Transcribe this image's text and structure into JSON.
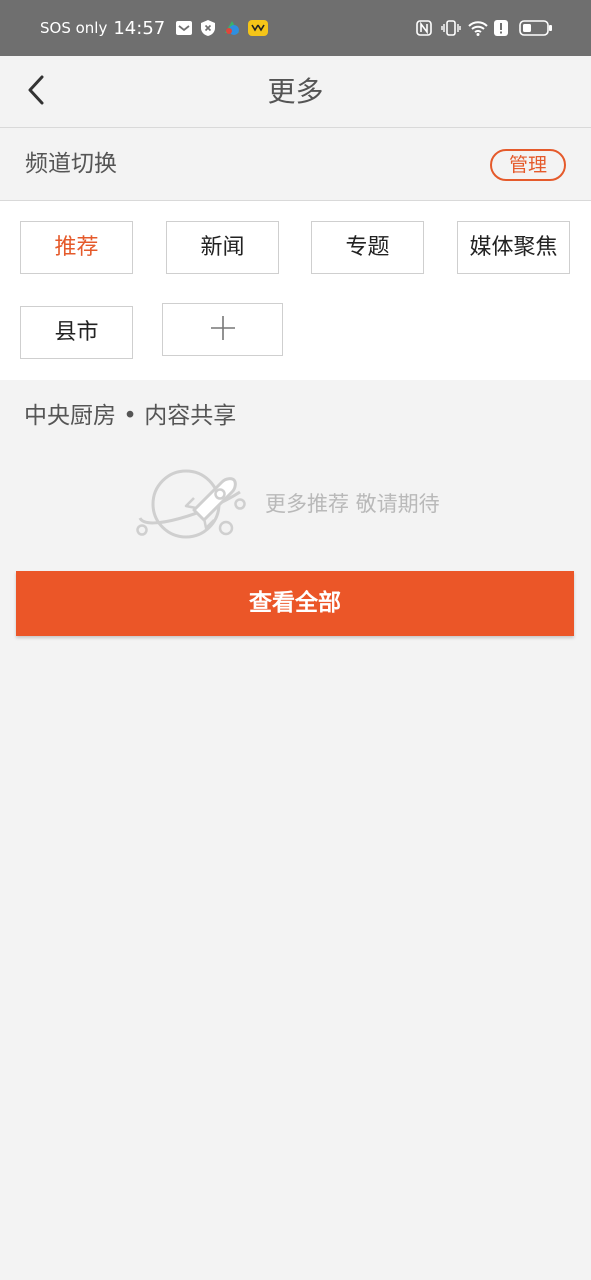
{
  "status_bar": {
    "carrier": "SOS only",
    "time": "14:57",
    "icons_left": [
      "mail-icon",
      "shield-icon",
      "app-icon",
      "app-icon"
    ],
    "icons_right": [
      "nfc-icon",
      "vibrate-icon",
      "wifi-icon",
      "alert-icon",
      "battery-icon"
    ]
  },
  "header": {
    "title": "更多",
    "back_icon": "chevron-left-icon"
  },
  "channel_switch": {
    "title": "频道切换",
    "manage_label": "管理",
    "channels": [
      {
        "label": "推荐",
        "active": true
      },
      {
        "label": "新闻",
        "active": false
      },
      {
        "label": "专题",
        "active": false
      },
      {
        "label": "媒体聚焦",
        "active": false
      },
      {
        "label": "县市",
        "active": false
      }
    ],
    "add_icon": "plus-icon"
  },
  "content_share": {
    "title": "中央厨房 • 内容共享",
    "empty_text": "更多推荐 敬请期待",
    "empty_icon": "rocket-planet-icon"
  },
  "view_all_label": "查看全部",
  "colors": {
    "accent": "#eb5628",
    "status_bar": "#6f6f6f",
    "background": "#f3f3f3"
  }
}
